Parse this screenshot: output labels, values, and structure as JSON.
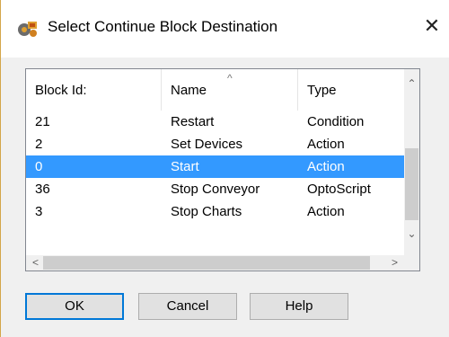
{
  "window": {
    "title": "Select Continue Block Destination",
    "close_label": "✕"
  },
  "list": {
    "columns": [
      "Block Id:",
      "Name",
      "Type"
    ],
    "sort_indicator": "^",
    "rows": [
      {
        "id": "21",
        "name": "Restart",
        "type": "Condition",
        "selected": false
      },
      {
        "id": "2",
        "name": "Set Devices",
        "type": "Action",
        "selected": false
      },
      {
        "id": "0",
        "name": "Start",
        "type": "Action",
        "selected": true
      },
      {
        "id": "36",
        "name": "Stop Conveyor",
        "type": "OptoScript",
        "selected": false
      },
      {
        "id": "3",
        "name": "Stop Charts",
        "type": "Action",
        "selected": false
      }
    ],
    "selection_color": "#3399ff"
  },
  "scrollbars": {
    "up": "⌃",
    "down": "⌄",
    "left": "<",
    "right": ">"
  },
  "buttons": {
    "ok": "OK",
    "cancel": "Cancel",
    "help": "Help"
  }
}
